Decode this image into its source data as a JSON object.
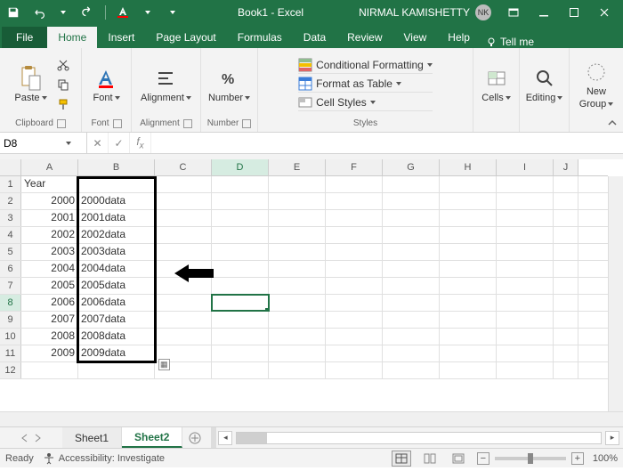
{
  "window": {
    "title": "Book1 - Excel",
    "user_name": "NIRMAL KAMISHETTY",
    "user_initials": "NK"
  },
  "tabs": {
    "file": "File",
    "list": [
      "Home",
      "Insert",
      "Page Layout",
      "Formulas",
      "Data",
      "Review",
      "View",
      "Help"
    ],
    "active": "Home",
    "tellme": "Tell me"
  },
  "ribbon": {
    "clipboard": {
      "paste": "Paste",
      "label": "Clipboard"
    },
    "font": {
      "btn": "Font",
      "label": "Font"
    },
    "alignment": {
      "btn": "Alignment",
      "label": "Alignment"
    },
    "number": {
      "btn": "Number",
      "label": "Number"
    },
    "styles": {
      "cond": "Conditional Formatting",
      "table": "Format as Table",
      "cell": "Cell Styles",
      "label": "Styles"
    },
    "cells": {
      "btn": "Cells"
    },
    "editing": {
      "btn": "Editing"
    },
    "newgroup": {
      "btn": "New",
      "btn2": "Group"
    }
  },
  "namebox": {
    "value": "D8"
  },
  "grid": {
    "columns": [
      "A",
      "B",
      "C",
      "D",
      "E",
      "F",
      "G",
      "H",
      "I",
      "J"
    ],
    "active_col": "D",
    "active_row": 8,
    "rows": [
      {
        "n": 1,
        "A": "Year",
        "B": ""
      },
      {
        "n": 2,
        "A": "2000",
        "B": "2000data"
      },
      {
        "n": 3,
        "A": "2001",
        "B": "2001data"
      },
      {
        "n": 4,
        "A": "2002",
        "B": "2002data"
      },
      {
        "n": 5,
        "A": "2003",
        "B": "2003data"
      },
      {
        "n": 6,
        "A": "2004",
        "B": "2004data"
      },
      {
        "n": 7,
        "A": "2005",
        "B": "2005data"
      },
      {
        "n": 8,
        "A": "2006",
        "B": "2006data"
      },
      {
        "n": 9,
        "A": "2007",
        "B": "2007data"
      },
      {
        "n": 10,
        "A": "2008",
        "B": "2008data"
      },
      {
        "n": 11,
        "A": "2009",
        "B": "2009data"
      },
      {
        "n": 12,
        "A": "",
        "B": ""
      }
    ]
  },
  "sheets": {
    "list": [
      "Sheet1",
      "Sheet2"
    ],
    "active": "Sheet2"
  },
  "status": {
    "ready": "Ready",
    "acc": "Accessibility: Investigate",
    "zoom": "100%"
  }
}
